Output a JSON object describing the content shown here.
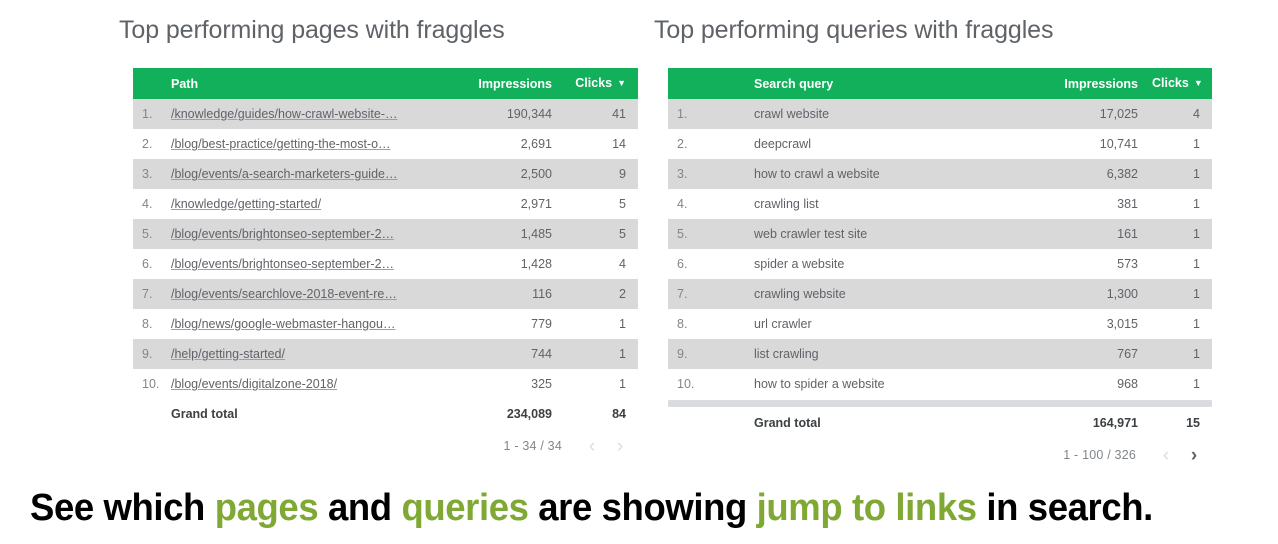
{
  "theme": {
    "header_green": "#12B05A",
    "row_alt": "#D9D9D9",
    "text_gray": "#5f6368",
    "caption_highlight": "#7FA934"
  },
  "pages_panel": {
    "title": "Top performing pages with fraggles",
    "columns": {
      "index": "",
      "main": "Path",
      "impressions": "Impressions",
      "clicks": "Clicks"
    },
    "sort_indicator": "▼",
    "rows": [
      {
        "idx": "1.",
        "main": "/knowledge/guides/how-crawl-website-…",
        "impressions": "190,344",
        "clicks": "41"
      },
      {
        "idx": "2.",
        "main": "/blog/best-practice/getting-the-most-o…",
        "impressions": "2,691",
        "clicks": "14"
      },
      {
        "idx": "3.",
        "main": "/blog/events/a-search-marketers-guide…",
        "impressions": "2,500",
        "clicks": "9"
      },
      {
        "idx": "4.",
        "main": "/knowledge/getting-started/",
        "impressions": "2,971",
        "clicks": "5"
      },
      {
        "idx": "5.",
        "main": "/blog/events/brightonseo-september-2…",
        "impressions": "1,485",
        "clicks": "5"
      },
      {
        "idx": "6.",
        "main": "/blog/events/brightonseo-september-2…",
        "impressions": "1,428",
        "clicks": "4"
      },
      {
        "idx": "7.",
        "main": "/blog/events/searchlove-2018-event-re…",
        "impressions": "116",
        "clicks": "2"
      },
      {
        "idx": "8.",
        "main": "/blog/news/google-webmaster-hangou…",
        "impressions": "779",
        "clicks": "1"
      },
      {
        "idx": "9.",
        "main": "/help/getting-started/",
        "impressions": "744",
        "clicks": "1"
      },
      {
        "idx": "10.",
        "main": "/blog/events/digitalzone-2018/",
        "impressions": "325",
        "clicks": "1"
      }
    ],
    "grand_total": {
      "label": "Grand total",
      "impressions": "234,089",
      "clicks": "84"
    },
    "pagination": {
      "range": "1 - 34 / 34",
      "prev": "‹",
      "next": "›",
      "prev_enabled": false,
      "next_enabled": false
    },
    "has_scrollbar": false
  },
  "queries_panel": {
    "title": "Top performing queries with fraggles",
    "columns": {
      "index": "",
      "main": "Search query",
      "impressions": "Impressions",
      "clicks": "Clicks"
    },
    "sort_indicator": "▼",
    "rows": [
      {
        "idx": "1.",
        "main": "crawl website",
        "impressions": "17,025",
        "clicks": "4"
      },
      {
        "idx": "2.",
        "main": "deepcrawl",
        "impressions": "10,741",
        "clicks": "1"
      },
      {
        "idx": "3.",
        "main": "how to crawl a website",
        "impressions": "6,382",
        "clicks": "1"
      },
      {
        "idx": "4.",
        "main": "crawling list",
        "impressions": "381",
        "clicks": "1"
      },
      {
        "idx": "5.",
        "main": "web crawler test site",
        "impressions": "161",
        "clicks": "1"
      },
      {
        "idx": "6.",
        "main": "spider a website",
        "impressions": "573",
        "clicks": "1"
      },
      {
        "idx": "7.",
        "main": "crawling website",
        "impressions": "1,300",
        "clicks": "1"
      },
      {
        "idx": "8.",
        "main": "url crawler",
        "impressions": "3,015",
        "clicks": "1"
      },
      {
        "idx": "9.",
        "main": "list crawling",
        "impressions": "767",
        "clicks": "1"
      },
      {
        "idx": "10.",
        "main": "how to spider a website",
        "impressions": "968",
        "clicks": "1"
      }
    ],
    "grand_total": {
      "label": "Grand total",
      "impressions": "164,971",
      "clicks": "15"
    },
    "pagination": {
      "range": "1 - 100 / 326",
      "prev": "‹",
      "next": "›",
      "prev_enabled": false,
      "next_enabled": true
    },
    "has_scrollbar": true
  },
  "caption": {
    "part1": "See which ",
    "hl1": "pages",
    "part2": " and ",
    "hl2": "queries",
    "part3": " are showing ",
    "hl3": "jump to links",
    "part4": " in search."
  }
}
